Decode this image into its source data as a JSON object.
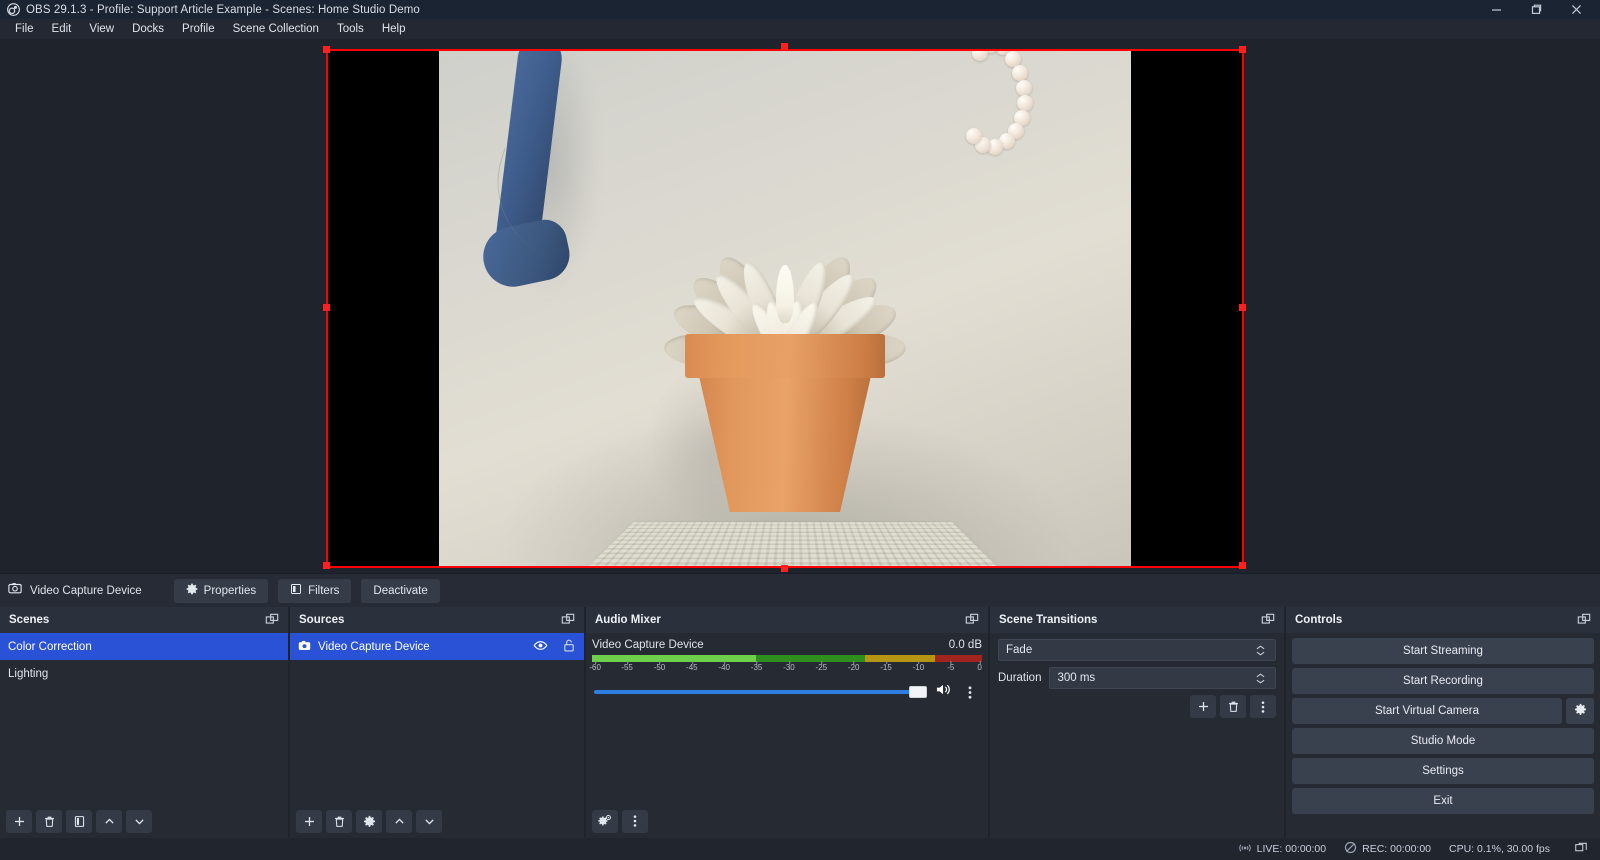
{
  "window": {
    "title": "OBS 29.1.3 - Profile: Support Article Example - Scenes: Home Studio Demo",
    "logo_icon": "obs-logo-icon",
    "minimize_icon": "minimize-icon",
    "restore_icon": "restore-icon",
    "close_icon": "close-icon"
  },
  "menubar": {
    "items": [
      {
        "label": "File"
      },
      {
        "label": "Edit"
      },
      {
        "label": "View"
      },
      {
        "label": "Docks"
      },
      {
        "label": "Profile"
      },
      {
        "label": "Scene Collection"
      },
      {
        "label": "Tools"
      },
      {
        "label": "Help"
      }
    ]
  },
  "preview": {
    "selection_color": "#ff0000",
    "canvas_background": "#000000"
  },
  "source_toolbar": {
    "source_icon": "camera-icon",
    "source_name": "Video Capture Device",
    "properties_label": "Properties",
    "properties_icon": "gear-icon",
    "filters_label": "Filters",
    "filters_icon": "filters-icon",
    "deactivate_label": "Deactivate"
  },
  "scenes": {
    "title": "Scenes",
    "float_icon": "undock-icon",
    "items": [
      {
        "label": "Color Correction",
        "selected": true
      },
      {
        "label": "Lighting",
        "selected": false
      }
    ],
    "toolbar": [
      {
        "icon": "plus-icon",
        "name": "add-scene-button"
      },
      {
        "icon": "trash-icon",
        "name": "remove-scene-button"
      },
      {
        "icon": "scene-filters-icon",
        "name": "scene-filters-button"
      },
      {
        "icon": "chevron-up-icon",
        "name": "move-scene-up-button"
      },
      {
        "icon": "chevron-down-icon",
        "name": "move-scene-down-button"
      }
    ]
  },
  "sources": {
    "title": "Sources",
    "float_icon": "undock-icon",
    "items": [
      {
        "label": "Video Capture Device",
        "selected": true,
        "type_icon": "camera-icon",
        "visibility_icon": "eye-icon",
        "lock_icon": "unlock-icon"
      }
    ],
    "toolbar": [
      {
        "icon": "plus-icon",
        "name": "add-source-button"
      },
      {
        "icon": "trash-icon",
        "name": "remove-source-button"
      },
      {
        "icon": "gear-icon",
        "name": "source-properties-button"
      },
      {
        "icon": "chevron-up-icon",
        "name": "move-source-up-button"
      },
      {
        "icon": "chevron-down-icon",
        "name": "move-source-down-button"
      }
    ]
  },
  "audio_mixer": {
    "title": "Audio Mixer",
    "float_icon": "undock-icon",
    "track_name": "Video Capture Device",
    "track_level": "0.0 dB",
    "meter_ticks": [
      "-60",
      "-55",
      "-50",
      "-45",
      "-40",
      "-35",
      "-30",
      "-25",
      "-20",
      "-15",
      "-10",
      "-5",
      "0"
    ],
    "volume_percent": 100,
    "mute_icon": "speaker-icon",
    "track_menu_icon": "vertical-dots-icon",
    "toolbar": [
      {
        "icon": "advanced-audio-icon",
        "name": "advanced-audio-properties-button"
      },
      {
        "icon": "vertical-dots-icon",
        "name": "audio-mixer-menu-button"
      }
    ]
  },
  "scene_transitions": {
    "title": "Scene Transitions",
    "float_icon": "undock-icon",
    "transition_value": "Fade",
    "duration_label": "Duration",
    "duration_value": "300 ms",
    "toolbar": [
      {
        "icon": "plus-icon",
        "name": "add-transition-button"
      },
      {
        "icon": "trash-icon",
        "name": "remove-transition-button"
      },
      {
        "icon": "vertical-dots-icon",
        "name": "transition-menu-button"
      }
    ]
  },
  "controls": {
    "title": "Controls",
    "float_icon": "undock-icon",
    "buttons": [
      {
        "label": "Start Streaming",
        "name": "start-streaming-button"
      },
      {
        "label": "Start Recording",
        "name": "start-recording-button"
      },
      {
        "label": "Start Virtual Camera",
        "name": "start-virtual-camera-button"
      },
      {
        "label": "Studio Mode",
        "name": "studio-mode-button"
      },
      {
        "label": "Settings",
        "name": "settings-button"
      },
      {
        "label": "Exit",
        "name": "exit-button"
      }
    ],
    "virtual_camera_config_icon": "gear-icon"
  },
  "statusbar": {
    "live_icon": "broadcast-icon",
    "live_text": "LIVE: 00:00:00",
    "rec_icon": "record-icon",
    "rec_text": "REC: 00:00:00",
    "cpu_text": "CPU: 0.1%, 30.00 fps",
    "resize_icon": "resize-grip-icon"
  }
}
